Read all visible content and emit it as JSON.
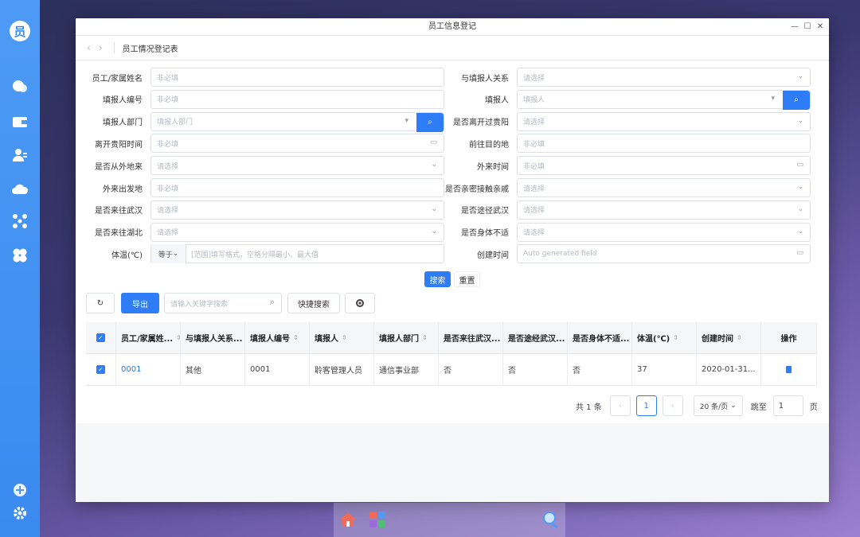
{
  "dock": {
    "avatar_text": "员",
    "icons": [
      "chat-icon",
      "wallet-icon",
      "contacts-icon",
      "cloud-icon",
      "network-icon",
      "apps-icon",
      "add-icon",
      "settings-icon"
    ]
  },
  "window": {
    "title": "员工信息登记",
    "breadcrumb": "员工情况登记表"
  },
  "form": {
    "left": [
      {
        "label": "员工/家属姓名",
        "placeholder": "非必填",
        "kind": "text"
      },
      {
        "label": "填报人编号",
        "placeholder": "非必填",
        "kind": "text"
      },
      {
        "label": "填报人部门",
        "placeholder": "填报人部门",
        "kind": "select-search"
      },
      {
        "label": "离开贵阳时间",
        "placeholder": "非必填",
        "kind": "date"
      },
      {
        "label": "是否从外地来",
        "placeholder": "请选择",
        "kind": "select"
      },
      {
        "label": "外来出发地",
        "placeholder": "非必填",
        "kind": "text"
      },
      {
        "label": "是否来往武汉",
        "placeholder": "请选择",
        "kind": "select"
      },
      {
        "label": "是否来往湖北",
        "placeholder": "请选择",
        "kind": "select"
      },
      {
        "label": "体温(℃)",
        "placeholder": "[范围]填写格式，空格分隔最小、最大值",
        "kind": "range",
        "operator": "等于"
      }
    ],
    "right": [
      {
        "label": "与填报人关系",
        "placeholder": "请选择",
        "kind": "select"
      },
      {
        "label": "填报人",
        "placeholder": "填报人",
        "kind": "select-search"
      },
      {
        "label": "是否离开过贵阳",
        "placeholder": "请选择",
        "kind": "select"
      },
      {
        "label": "前往目的地",
        "placeholder": "非必填",
        "kind": "text"
      },
      {
        "label": "外来时间",
        "placeholder": "非必填",
        "kind": "date"
      },
      {
        "label": "是否亲密接触亲戚",
        "placeholder": "请选择",
        "kind": "select"
      },
      {
        "label": "是否途径武汉",
        "placeholder": "请选择",
        "kind": "select"
      },
      {
        "label": "是否身体不适",
        "placeholder": "请选择",
        "kind": "select"
      },
      {
        "label": "创建时间",
        "placeholder": "Auto generated field",
        "kind": "date"
      }
    ],
    "search_label": "搜索",
    "reset_label": "重置"
  },
  "toolbar": {
    "export_label": "导出",
    "keyword_placeholder": "请输入关键字搜索",
    "quick_search_label": "快捷搜索"
  },
  "table": {
    "columns": [
      "员工/家属姓...",
      "与填报人关系...",
      "填报人编号",
      "填报人",
      "填报人部门",
      "是否来往武汉...",
      "是否途经武汉...",
      "是否身体不适...",
      "体温(℃)",
      "创建时间",
      "操作"
    ],
    "rows": [
      [
        "0001",
        "其他",
        "0001",
        "聆客管理人员",
        "通信事业部",
        "否",
        "否",
        "否",
        "37",
        "2020-01-31..."
      ]
    ]
  },
  "pagination": {
    "total": "共 1 条",
    "current_page": "1",
    "page_size": "20 条/页",
    "goto_label": "跳至",
    "goto_value": "1",
    "page_suffix": "页"
  },
  "colors": {
    "dock": "#4d9bf5",
    "primary": "#2e7cf6"
  }
}
